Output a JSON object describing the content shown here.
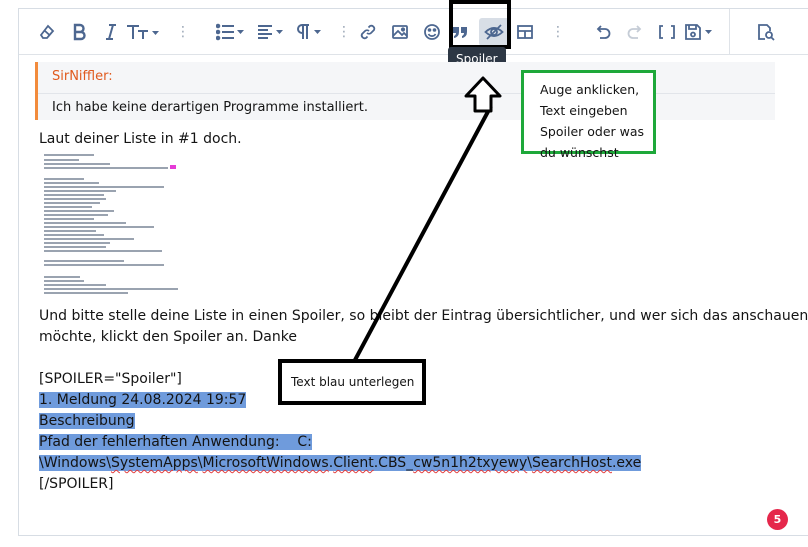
{
  "toolbar": {
    "buttons": [
      {
        "icon": "eraser-icon",
        "label": "Remove formatting"
      },
      {
        "icon": "bold-icon",
        "label": "Bold"
      },
      {
        "icon": "italic-icon",
        "label": "Italic"
      },
      {
        "icon": "text-size-icon",
        "label": "Font size"
      },
      {
        "icon": "list-icon",
        "label": "List"
      },
      {
        "icon": "align-icon",
        "label": "Align"
      },
      {
        "icon": "paragraph-icon",
        "label": "Paragraph"
      },
      {
        "icon": "link-icon",
        "label": "Link"
      },
      {
        "icon": "image-icon",
        "label": "Image"
      },
      {
        "icon": "smiley-icon",
        "label": "Smilies"
      },
      {
        "icon": "quote-icon",
        "label": "Quote"
      },
      {
        "icon": "spoiler-icon",
        "label": "Spoiler"
      },
      {
        "icon": "table-icon",
        "label": "Table"
      },
      {
        "icon": "undo-icon",
        "label": "Undo"
      },
      {
        "icon": "redo-icon",
        "label": "Redo"
      },
      {
        "icon": "bbcode-icon",
        "label": "Toggle BB code"
      },
      {
        "icon": "save-icon",
        "label": "Drafts"
      },
      {
        "icon": "preview-icon",
        "label": "Preview"
      }
    ],
    "tooltip": "Spoiler"
  },
  "quote": {
    "author": "SirNiffler:",
    "text": "Ich habe keine derartigen Programme installiert."
  },
  "body": {
    "line1": "Laut deiner Liste in #1 doch.",
    "para_line1": "Und bitte stelle deine Liste in einen Spoiler, so bleibt der Eintrag übersichtlicher, und wer sich das anschauen",
    "para_line2": "möchte, klickt den Spoiler an. Danke",
    "spoiler_open": "[SPOILER=\"Spoiler\"]",
    "sel_line1": "1. Meldung 24.08.2024 19:57",
    "sel_line2": "Beschreibung",
    "sel_line3": "Pfad der fehlerhaften Anwendung:    C:",
    "sel_line4_parts": [
      "\\Windows\\",
      "SystemApps",
      "\\",
      "MicrosoftWindows",
      ".",
      "Client",
      ".CBS_",
      "cw5n1h2txyewy",
      "\\",
      "SearchHost",
      ".exe"
    ],
    "spoiler_close": "[/SPOILER]"
  },
  "annotations": {
    "green_lines": [
      "Auge anklicken,",
      "Text eingeben",
      "Spoiler oder was",
      "du wünschst"
    ],
    "black_label": "Text blau unterlegen"
  },
  "badge": "5",
  "colors": {
    "icon": "#4d6790",
    "selection": "#6f9bdc",
    "quote_accent": "#f28b3c",
    "green_annotation": "#1ea83a",
    "badge": "#e5274b"
  }
}
